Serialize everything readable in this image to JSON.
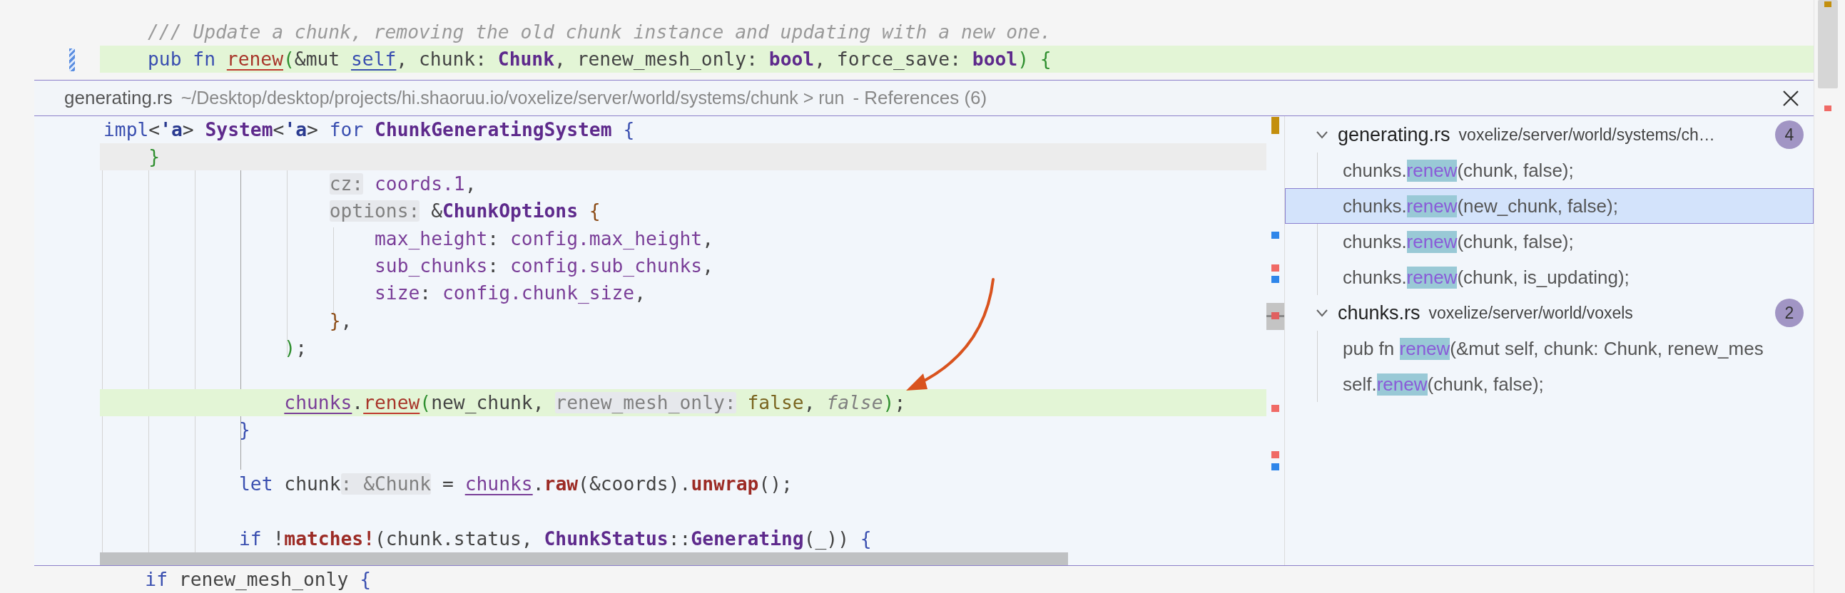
{
  "editor": {
    "lines": [
      {
        "kind": "code",
        "highlighted": false,
        "modified": false,
        "tokens": [
          {
            "kind": "comment",
            "text": "/// Update a chunk, removing the old chunk instance and updating with a new one."
          }
        ]
      },
      {
        "kind": "code",
        "highlighted": true,
        "modified": true,
        "tokens": [
          {
            "kind": "kw",
            "text": "pub fn "
          },
          {
            "kind": "fnu",
            "text": "renew"
          },
          {
            "kind": "braceg",
            "text": "("
          },
          {
            "kind": "plain",
            "text": "&mut "
          },
          {
            "kind": "selfu",
            "text": "self"
          },
          {
            "kind": "plain",
            "text": ", chunk: "
          },
          {
            "kind": "type",
            "text": "Chunk"
          },
          {
            "kind": "plain",
            "text": ", renew_mesh_only: "
          },
          {
            "kind": "type",
            "text": "bool"
          },
          {
            "kind": "plain",
            "text": ", force_save: "
          },
          {
            "kind": "type",
            "text": "bool"
          },
          {
            "kind": "braceg",
            "text": ") {"
          }
        ]
      }
    ]
  },
  "peek": {
    "file": "generating.rs",
    "path": "~/Desktop/desktop/projects/hi.shaoruu.io/voxelize/server/world/systems/chunk > run",
    "title": "- References (6)",
    "sticky_lines": [
      {
        "kind": "code",
        "highlighted": false,
        "tokens": [
          {
            "kind": "kw",
            "text": "impl"
          },
          {
            "kind": "plain",
            "text": "<"
          },
          {
            "kind": "lifetime",
            "text": "'a"
          },
          {
            "kind": "plain",
            "text": "> "
          },
          {
            "kind": "type",
            "text": "System"
          },
          {
            "kind": "plain",
            "text": "<"
          },
          {
            "kind": "lifetime",
            "text": "'a"
          },
          {
            "kind": "plain",
            "text": "> "
          },
          {
            "kind": "kw",
            "text": "for "
          },
          {
            "kind": "type",
            "text": "ChunkGeneratingSystem"
          },
          {
            "kind": "braceb",
            "text": " {"
          }
        ]
      },
      {
        "kind": "code",
        "highlighted": true,
        "tokens": [
          {
            "kind": "braceg",
            "text": "    }"
          }
        ]
      }
    ],
    "lines": [
      {
        "kind": "code",
        "highlighted": false,
        "tokens": [
          {
            "kind": "hint",
            "text": "                    cz:"
          },
          {
            "kind": "var",
            "text": " coords.1"
          },
          {
            "kind": "plain",
            "text": ","
          }
        ]
      },
      {
        "kind": "code",
        "highlighted": false,
        "tokens": [
          {
            "kind": "hint",
            "text": "                    options:"
          },
          {
            "kind": "plain",
            "text": " &"
          },
          {
            "kind": "type",
            "text": "ChunkOptions"
          },
          {
            "kind": "braceo",
            "text": " {"
          }
        ]
      },
      {
        "kind": "code",
        "highlighted": false,
        "tokens": [
          {
            "kind": "var",
            "text": "                        max_height"
          },
          {
            "kind": "plain",
            "text": ": "
          },
          {
            "kind": "var",
            "text": "config.max_height"
          },
          {
            "kind": "plain",
            "text": ","
          }
        ]
      },
      {
        "kind": "code",
        "highlighted": false,
        "tokens": [
          {
            "kind": "var",
            "text": "                        sub_chunks"
          },
          {
            "kind": "plain",
            "text": ": "
          },
          {
            "kind": "var",
            "text": "config.sub_chunks"
          },
          {
            "kind": "plain",
            "text": ","
          }
        ]
      },
      {
        "kind": "code",
        "highlighted": false,
        "tokens": [
          {
            "kind": "var",
            "text": "                        size"
          },
          {
            "kind": "plain",
            "text": ": "
          },
          {
            "kind": "var",
            "text": "config.chunk_size"
          },
          {
            "kind": "plain",
            "text": ","
          }
        ]
      },
      {
        "kind": "code",
        "highlighted": false,
        "tokens": [
          {
            "kind": "braceo",
            "text": "                    }"
          },
          {
            "kind": "plain",
            "text": ","
          }
        ]
      },
      {
        "kind": "code",
        "highlighted": false,
        "tokens": [
          {
            "kind": "braceg",
            "text": "                )"
          },
          {
            "kind": "plain",
            "text": ";"
          }
        ]
      },
      {
        "kind": "blank",
        "highlighted": false
      },
      {
        "kind": "code",
        "highlighted": true,
        "tokens": [
          {
            "kind": "varu",
            "text": "                chunks"
          },
          {
            "kind": "plain",
            "text": "."
          },
          {
            "kind": "fnu",
            "text": "renew"
          },
          {
            "kind": "braceg",
            "text": "("
          },
          {
            "kind": "plain",
            "text": "new_chunk, "
          },
          {
            "kind": "hint",
            "text": "renew_mesh_only:"
          },
          {
            "kind": "lit",
            "text": " false"
          },
          {
            "kind": "plain",
            "text": ", "
          },
          {
            "kind": "italic",
            "text": "false"
          },
          {
            "kind": "braceg",
            "text": ")"
          },
          {
            "kind": "plain",
            "text": ";"
          }
        ]
      },
      {
        "kind": "code",
        "highlighted": false,
        "tokens": [
          {
            "kind": "braceb",
            "text": "            }"
          }
        ]
      },
      {
        "kind": "blank",
        "highlighted": false
      },
      {
        "kind": "code",
        "highlighted": false,
        "tokens": [
          {
            "kind": "kw",
            "text": "            let "
          },
          {
            "kind": "plain",
            "text": "chunk"
          },
          {
            "kind": "hint",
            "text": ": &Chunk"
          },
          {
            "kind": "plain",
            "text": " = "
          },
          {
            "kind": "varu",
            "text": "chunks"
          },
          {
            "kind": "plain",
            "text": "."
          },
          {
            "kind": "fn",
            "text": "raw"
          },
          {
            "kind": "plain",
            "text": "(&coords)."
          },
          {
            "kind": "fn",
            "text": "unwrap"
          },
          {
            "kind": "plain",
            "text": "();"
          }
        ]
      },
      {
        "kind": "blank",
        "highlighted": false
      },
      {
        "kind": "code",
        "highlighted": false,
        "tokens": [
          {
            "kind": "kw",
            "text": "            if "
          },
          {
            "kind": "plain",
            "text": "!"
          },
          {
            "kind": "fn",
            "text": "matches!"
          },
          {
            "kind": "plain",
            "text": "(chunk.status, "
          },
          {
            "kind": "type",
            "text": "ChunkStatus"
          },
          {
            "kind": "plain",
            "text": "::"
          },
          {
            "kind": "type",
            "text": "Generating"
          },
          {
            "kind": "plain",
            "text": "(_))"
          },
          {
            "kind": "braceb",
            "text": " {"
          }
        ]
      }
    ]
  },
  "references": {
    "groups": [
      {
        "file": "generating.rs",
        "path": "voxelize/server/world/systems/ch…",
        "count": "4",
        "expanded": true,
        "items": [
          {
            "prefix": "chunks.",
            "match": "renew",
            "suffix": "(chunk, false);",
            "selected": false
          },
          {
            "prefix": "chunks.",
            "match": "renew",
            "suffix": "(new_chunk, false);",
            "selected": true
          },
          {
            "prefix": "chunks.",
            "match": "renew",
            "suffix": "(chunk, false);",
            "selected": false
          },
          {
            "prefix": "chunks.",
            "match": "renew",
            "suffix": "(chunk, is_updating);",
            "selected": false
          }
        ]
      },
      {
        "file": "chunks.rs",
        "path": "voxelize/server/world/voxels",
        "count": "2",
        "expanded": true,
        "items": [
          {
            "prefix": "pub fn ",
            "match": "renew",
            "suffix": "(&mut self, chunk: Chunk, renew_mes",
            "selected": false
          },
          {
            "prefix": "self.",
            "match": "renew",
            "suffix": "(chunk, false);",
            "selected": false
          }
        ]
      }
    ]
  },
  "bottom_editor": {
    "lines": [
      {
        "kind": "code",
        "highlighted": false,
        "tokens": [
          {
            "kind": "kw",
            "text": "    if "
          },
          {
            "kind": "plain",
            "text": "renew_mesh_only"
          },
          {
            "kind": "braceb",
            "text": " {"
          }
        ]
      }
    ]
  }
}
